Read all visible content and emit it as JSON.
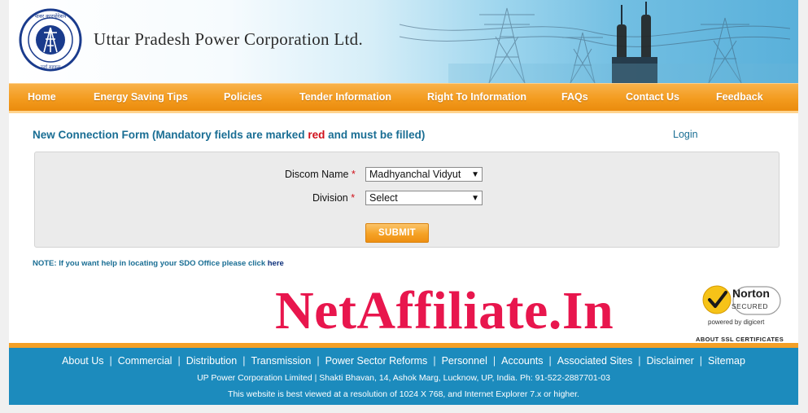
{
  "header": {
    "company_name": "Uttar Pradesh Power Corporation Ltd.",
    "logo_text_top": "पावर कारपोरेशन लिमिटेड",
    "logo_text_bottom": "उर्जा, सहकार एवं श्रम"
  },
  "nav": {
    "items": [
      {
        "label": "Home"
      },
      {
        "label": "Energy Saving Tips"
      },
      {
        "label": "Policies"
      },
      {
        "label": "Tender Information"
      },
      {
        "label": "Right To Information"
      },
      {
        "label": "FAQs"
      },
      {
        "label": "Contact Us"
      },
      {
        "label": "Feedback"
      }
    ]
  },
  "form": {
    "title_prefix": "New Connection Form (Mandatory fields are marked ",
    "title_red": "red",
    "title_suffix": " and must be filled)",
    "login_label": "Login",
    "discom_label": "Discom Name",
    "discom_value": "Madhyanchal Vidyut",
    "division_label": "Division",
    "division_value": "Select",
    "required_mark": "*",
    "submit_label": "SUBMIT"
  },
  "note": {
    "text": "NOTE: If you want help in locating your SDO Office please click ",
    "link": "here"
  },
  "watermark": "NetAffiliate.In",
  "norton": {
    "name": "Norton",
    "secured": "SECURED",
    "powered_by": "powered by digicert",
    "about_ssl": "ABOUT SSL CERTIFICATES"
  },
  "footer": {
    "links": [
      {
        "label": "About Us"
      },
      {
        "label": "Commercial"
      },
      {
        "label": "Distribution"
      },
      {
        "label": "Transmission"
      },
      {
        "label": "Power Sector Reforms"
      },
      {
        "label": "Personnel"
      },
      {
        "label": "Accounts"
      },
      {
        "label": "Associated Sites"
      },
      {
        "label": "Disclaimer"
      },
      {
        "label": "Sitemap"
      }
    ],
    "address": "UP Power Corporation Limited | Shakti Bhavan, 14, Ashok Marg, Lucknow, UP, India. Ph: 91-522-2887701-03",
    "view_note": "This website is best viewed at a resolution of 1024 X 768, and Internet Explorer 7.x or higher."
  },
  "colors": {
    "nav_orange": "#f39b1e",
    "title_blue": "#1a6e94",
    "required_red": "#d0101a",
    "footer_blue": "#1c8bbd",
    "watermark_pink": "#e8164d"
  }
}
